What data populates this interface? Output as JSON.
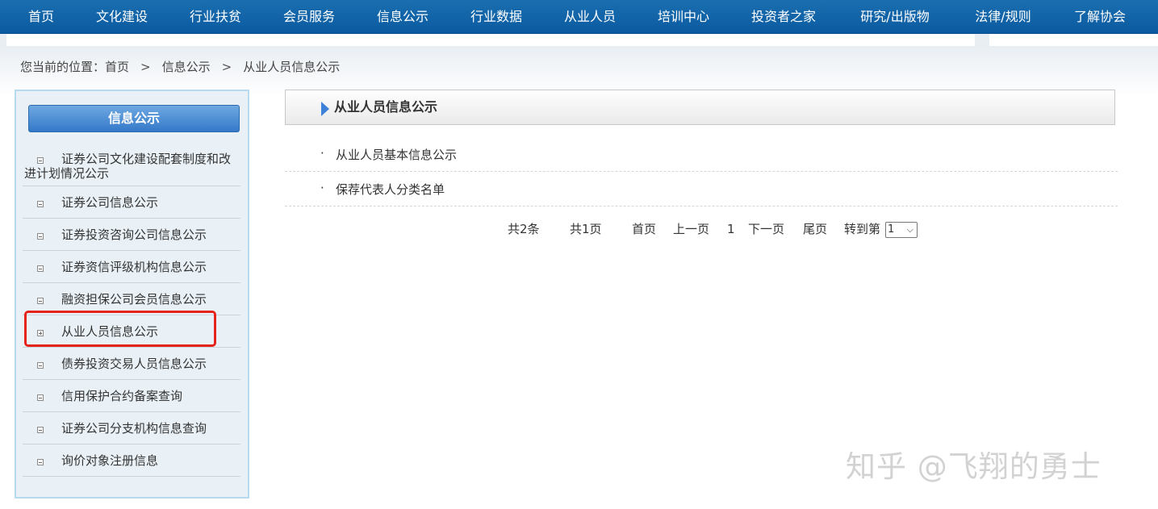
{
  "nav": {
    "items": [
      "首页",
      "文化建设",
      "行业扶贫",
      "会员服务",
      "信息公示",
      "行业数据",
      "从业人员",
      "培训中心",
      "投资者之家",
      "研究/出版物",
      "法律/规则",
      "了解协会"
    ]
  },
  "breadcrumb": {
    "prefix": "您当前的位置：",
    "items": [
      "首页",
      "信息公示",
      "从业人员信息公示"
    ],
    "separator": ">"
  },
  "sidebar": {
    "title": "信息公示",
    "items": [
      {
        "label": "证券公司文化建设配套制度和改进计划情况公示",
        "expanded": true
      },
      {
        "label": "证券公司信息公示",
        "expanded": true
      },
      {
        "label": "证券投资咨询公司信息公示",
        "expanded": true
      },
      {
        "label": "证券资信评级机构信息公示",
        "expanded": true
      },
      {
        "label": "融资担保公司会员信息公示",
        "expanded": true
      },
      {
        "label": "从业人员信息公示",
        "expanded": false,
        "highlighted": true
      },
      {
        "label": "债券投资交易人员信息公示",
        "expanded": true
      },
      {
        "label": "信用保护合约备案查询",
        "expanded": true
      },
      {
        "label": "证券公司分支机构信息查询",
        "expanded": true
      },
      {
        "label": "询价对象注册信息",
        "expanded": true
      }
    ]
  },
  "main": {
    "title": "从业人员信息公示",
    "list": [
      {
        "bullet": "·",
        "label": "从业人员基本信息公示"
      },
      {
        "bullet": "·",
        "label": "保荐代表人分类名单"
      }
    ]
  },
  "pager": {
    "total_records": "共2条",
    "total_pages": "共1页",
    "first": "首页",
    "prev": "上一页",
    "current": "1",
    "next": "下一页",
    "last": "尾页",
    "goto": "转到第",
    "selected_page": "1"
  },
  "watermark": "知乎 @飞翔的勇士",
  "colors": {
    "nav_bg": "#0b5aa0",
    "sidebar_border": "#b6dbef",
    "sidebar_bg": "#e9f1f6",
    "highlight": "#e5231b",
    "accent_blue": "#3d82d8",
    "current_page": "#d42020"
  }
}
